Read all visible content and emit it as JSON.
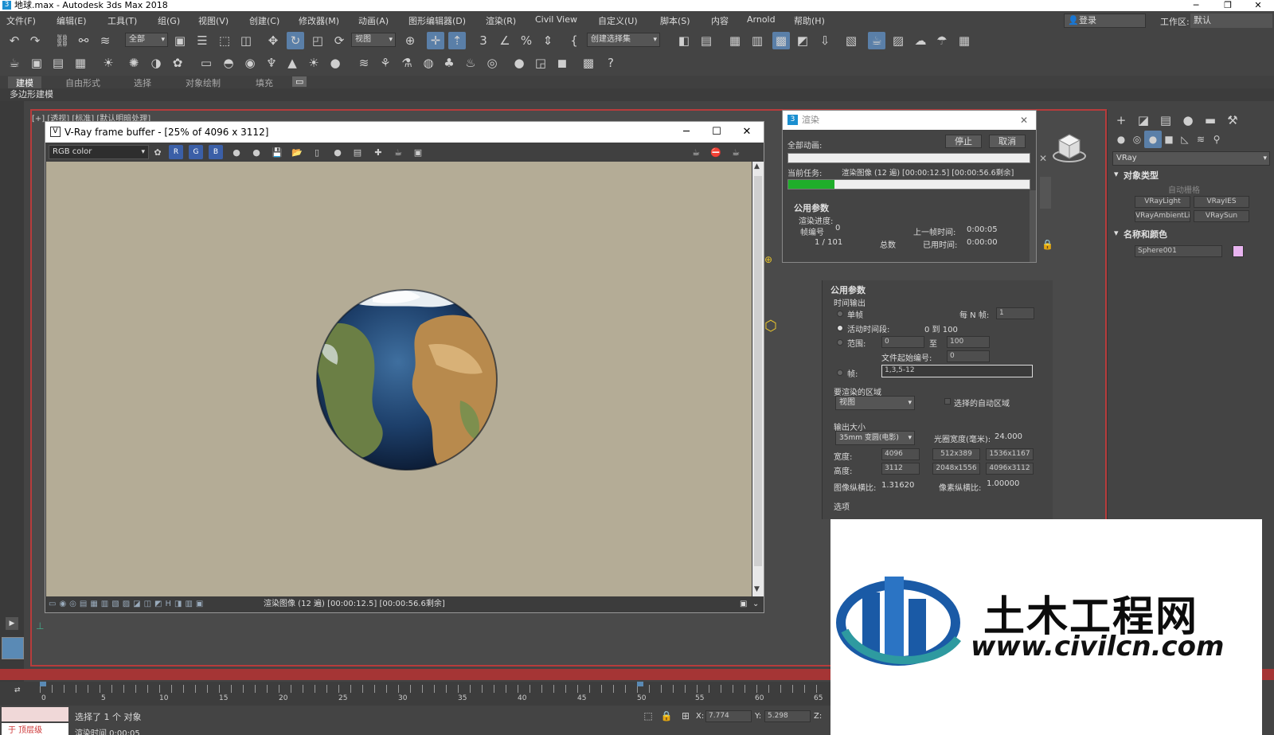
{
  "window": {
    "title": "地球.max - Autodesk 3ds Max 2018",
    "app_icon": "3",
    "min": "─",
    "max": "❐",
    "close": "✕"
  },
  "menu": [
    "文件(F)",
    "编辑(E)",
    "工具(T)",
    "组(G)",
    "视图(V)",
    "创建(C)",
    "修改器(M)",
    "动画(A)",
    "图形编辑器(D)",
    "渲染(R)",
    "Civil View",
    "自定义(U)",
    "脚本(S)",
    "内容",
    "Arnold",
    "帮助(H)"
  ],
  "account": {
    "login": "登录",
    "workspace_label": "工作区:",
    "workspace_value": "默认"
  },
  "toolbar": {
    "selection_filter": "全部",
    "ref_coord": "视图",
    "named_selection": "创建选择集"
  },
  "ribbon": {
    "tabs": [
      "建模",
      "自由形式",
      "选择",
      "对象绘制",
      "填充"
    ],
    "active": "建模",
    "sub_label": "多边形建模"
  },
  "viewport": {
    "label": "[+] [透视] [标准] [默认明暗处理]"
  },
  "vfb": {
    "title": "V-Ray frame buffer - [25% of 4096 x 3112]",
    "channel": "RGB color",
    "rgb": [
      "R",
      "G",
      "B"
    ],
    "status_text": "渲染图像 (12 遍) [00:00:12.5] [00:00:56.6剩余]"
  },
  "render_dialog": {
    "title": "渲染",
    "stop_label": "停止",
    "cancel_label": "取消",
    "total_anim_label": "全部动画:",
    "total_progress": 0.0,
    "current_task_label": "当前任务:",
    "current_task_text": "渲染图像 (12 遍) [00:00:12.5] [00:00:56.6剩余]",
    "current_progress": 0.19,
    "common_params": "公用参数",
    "render_progress": "渲染进度:",
    "frame_no_label": "帧编号",
    "frame_no": "0",
    "frame_count": "1 / 101",
    "total_label": "总数",
    "last_frame_time_label": "上一帧时间:",
    "last_frame_time": "0:00:05",
    "elapsed_label": "已用时间:",
    "elapsed": "0:00:00"
  },
  "settings": {
    "section": "公用参数",
    "time_output": "时间输出",
    "single": "单帧",
    "every_nth": "每 N 帧:",
    "every_nth_value": "1",
    "active_segment": "活动时间段:",
    "active_range": "0 到 100",
    "range": "范围:",
    "range_from": "0",
    "range_to_label": "至",
    "range_to": "100",
    "file_start_label": "文件起始编号:",
    "file_start": "0",
    "frames": "帧:",
    "frames_value": "1,3,5-12",
    "area_label": "要渲染的区域",
    "area_value": "视图",
    "auto_region": "选择的自动区域",
    "output_size": "输出大小",
    "film_preset": "35mm 变圆(电影)",
    "aperture_label": "光圈宽度(毫米):",
    "aperture": "24.000",
    "width_label": "宽度:",
    "width": "4096",
    "height_label": "高度:",
    "height": "3112",
    "presets": [
      "512x389",
      "1536x1167",
      "2048x1556",
      "4096x3112"
    ],
    "image_aspect_label": "图像纵横比:",
    "image_aspect": "1.31620",
    "pixel_aspect_label": "像素纵横比:",
    "pixel_aspect": "1.00000",
    "options": "选项"
  },
  "cmd_panel": {
    "renderer": "VRay",
    "object_type": "对象类型",
    "auto_grid": "自动栅格",
    "buttons": [
      "VRayLight",
      "VRayIES",
      "VRayAmbientLight",
      "VRaySun"
    ],
    "name_color": "名称和颜色",
    "object_name": "Sphere001",
    "object_color": "#e8b4f0"
  },
  "timeline": {
    "ticks": [
      "0",
      "5",
      "10",
      "15",
      "20",
      "25",
      "30",
      "35",
      "40",
      "45",
      "50",
      "55",
      "60",
      "65"
    ],
    "status_selected": "选择了 1 个 对象",
    "render_time": "渲染时间 0:00:05",
    "layer": "于 顶层级",
    "x_label": "X:",
    "x_value": "7.774",
    "y_label": "Y:",
    "y_value": "5.298",
    "z_label": "Z:"
  },
  "watermark": {
    "title": "土木工程网",
    "url": "www.civilcn.com"
  }
}
